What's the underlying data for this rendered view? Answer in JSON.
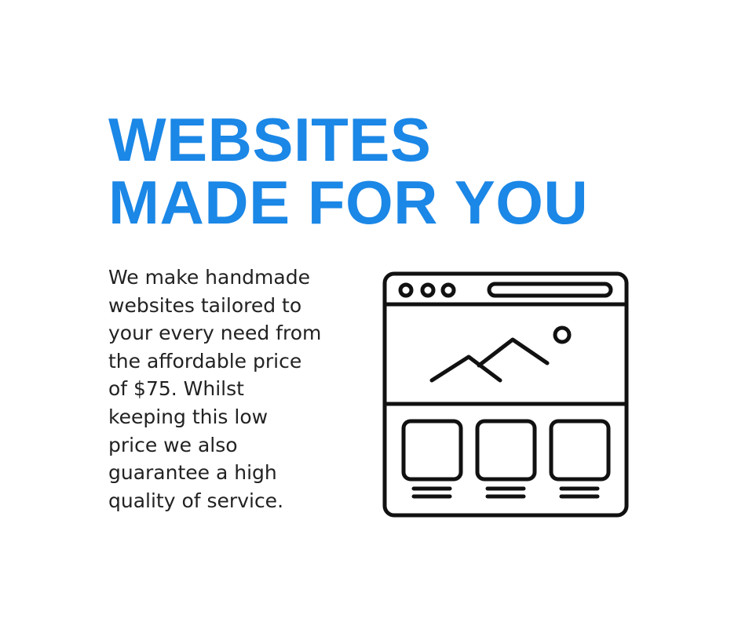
{
  "headline": {
    "lines": [
      "WEBSITES",
      "MADE FOR YOU"
    ],
    "color": "#1b87e6"
  },
  "description": {
    "lines": [
      "We make handmade",
      "websites tailored to",
      "your every need from",
      "the affordable price",
      "of $75. Whilst",
      "keeping this low",
      "price we also",
      "guarantee a high",
      "quality of service."
    ],
    "color": "#222222"
  },
  "illustration": {
    "icon": "website-layout-icon",
    "stroke_color": "#111111"
  }
}
